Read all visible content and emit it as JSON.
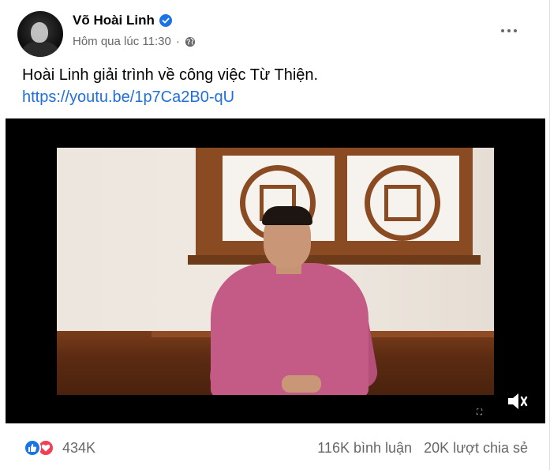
{
  "post": {
    "author": "Võ Hoài Linh",
    "timestamp": "Hôm qua lúc 11:30",
    "separator": "·",
    "text": "Hoài Linh giải trình về công việc Từ Thiện.",
    "link": "https://youtu.be/1p7Ca2B0-qU"
  },
  "icons": {
    "verified": "verified-badge-icon",
    "privacy": "globe-icon",
    "more": "more-options-icon",
    "mute": "muted-speaker-icon",
    "like": "like-icon",
    "love": "love-icon"
  },
  "video": {
    "caption_mark": "⛶"
  },
  "engagement": {
    "reactions_count": "434K",
    "comments": "116K bình luận",
    "shares": "20K lượt chia sẻ"
  },
  "colors": {
    "link": "#216fdb",
    "verified": "#1b74e4",
    "like": "#1b74e4",
    "love": "#f33e58",
    "muted_text": "#65676b"
  }
}
